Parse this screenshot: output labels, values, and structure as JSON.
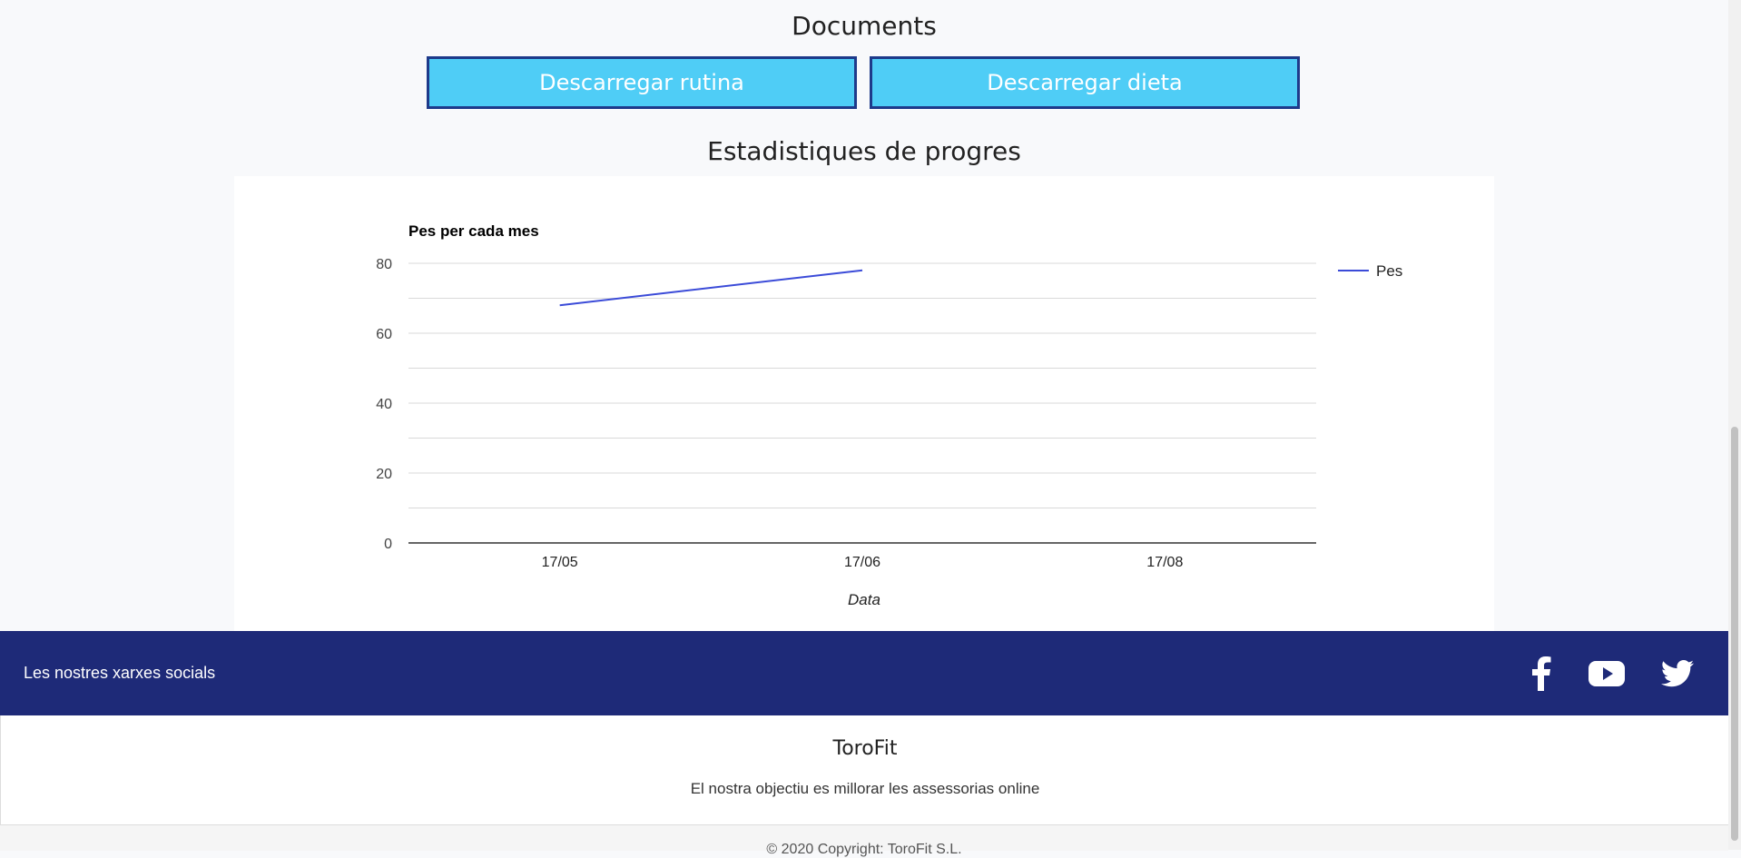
{
  "documents": {
    "title": "Documents",
    "download_routine_label": "Descarregar rutina",
    "download_diet_label": "Descarregar dieta"
  },
  "stats": {
    "title": "Estadistiques de progres"
  },
  "chart_data": {
    "type": "line",
    "title": "Pes per cada mes",
    "xlabel": "Data",
    "ylabel": "",
    "categories": [
      "17/05",
      "17/06",
      "17/08"
    ],
    "series": [
      {
        "name": "Pes",
        "values": [
          68,
          78,
          null
        ],
        "color": "#3b4bd8"
      }
    ],
    "ylim": [
      0,
      80
    ],
    "yticks": [
      0,
      20,
      40,
      60,
      80
    ],
    "grid": true,
    "legend": "right"
  },
  "footer": {
    "social_label": "Les nostres xarxes socials",
    "icons": [
      "facebook-icon",
      "youtube-icon",
      "twitter-icon"
    ],
    "brand": "ToroFit",
    "tagline": "El nostra objectiu es millorar les assessorias online",
    "copyright": "© 2020 Copyright: ToroFit S.L."
  },
  "colors": {
    "button_bg": "#4fcdf6",
    "button_border": "#1e3a8a",
    "footer_bg": "#1e2a78"
  }
}
